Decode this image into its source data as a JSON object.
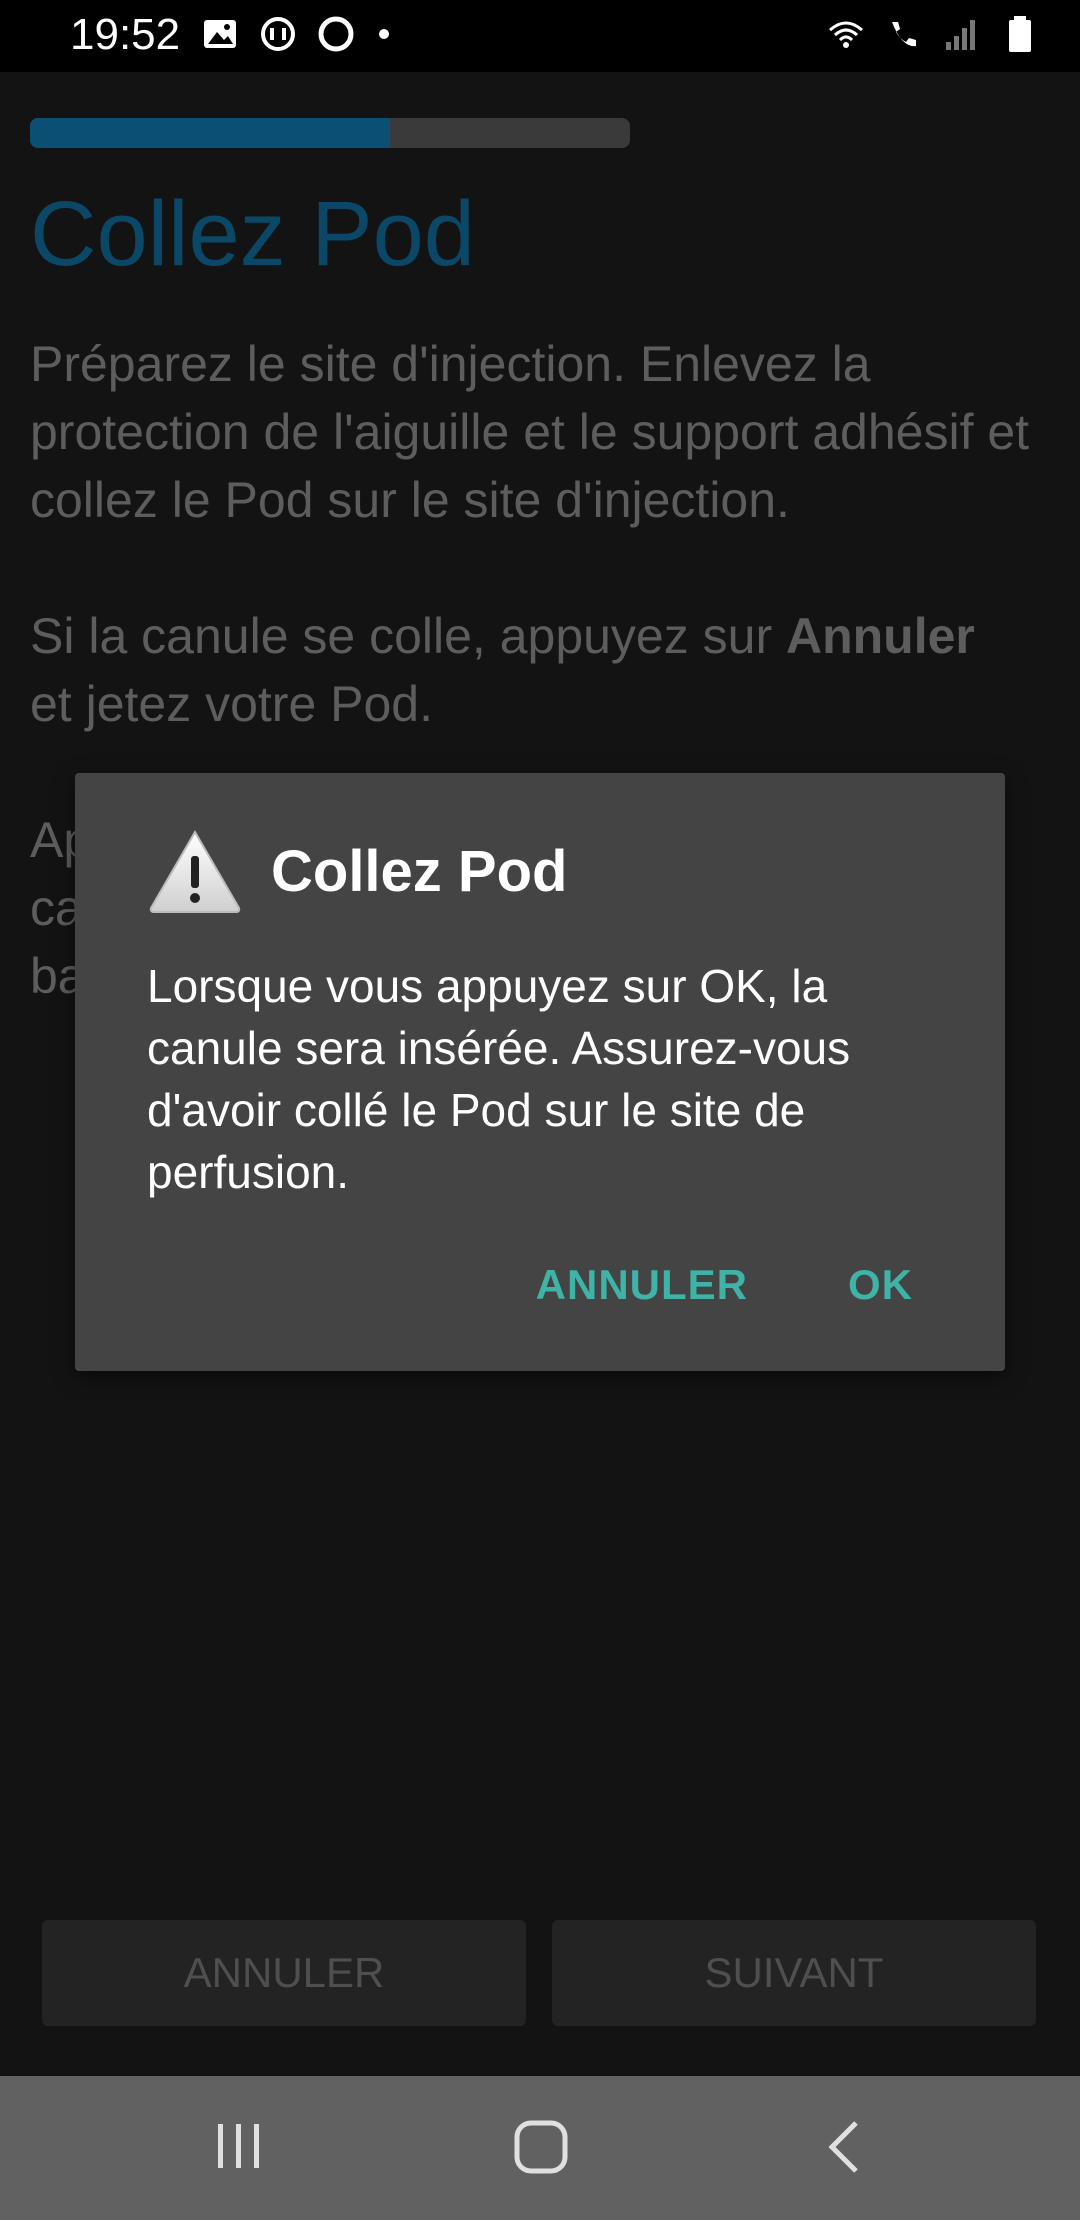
{
  "status_bar": {
    "time": "19:52",
    "left_icons": [
      "image-icon",
      "sync-icon",
      "circle-icon",
      "dot-icon"
    ],
    "right_icons": [
      "wifi-icon",
      "wifi-call-icon",
      "signal-icon",
      "battery-icon"
    ]
  },
  "screen": {
    "progress": 0.6,
    "title": "Collez Pod",
    "paragraph1": "Préparez le site d'injection. Enlevez la protection de l'aiguille et le support adhésif et collez le Pod sur le site d'injection.",
    "paragraph2_start": "Si la canule se colle, appuyez sur ",
    "paragraph2_bold": "Annuler",
    "paragraph2_end": " et jetez votre Pod.",
    "paragraph3": "Ap ca ba",
    "buttons": {
      "cancel": "ANNULER",
      "next": "SUIVANT"
    }
  },
  "dialog": {
    "icon": "warning-icon",
    "title": "Collez Pod",
    "message": "Lorsque vous appuyez sur OK, la canule sera insérée. Assurez-vous d'avoir collé le Pod sur le site de perfusion.",
    "cancel": "ANNULER",
    "ok": "OK"
  },
  "nav_bar": {
    "icons": [
      "recents-icon",
      "home-icon",
      "back-icon"
    ]
  },
  "colors": {
    "accent": "#3eb3a6",
    "title_blue": "#0b4766",
    "dialog_bg": "#444444"
  }
}
